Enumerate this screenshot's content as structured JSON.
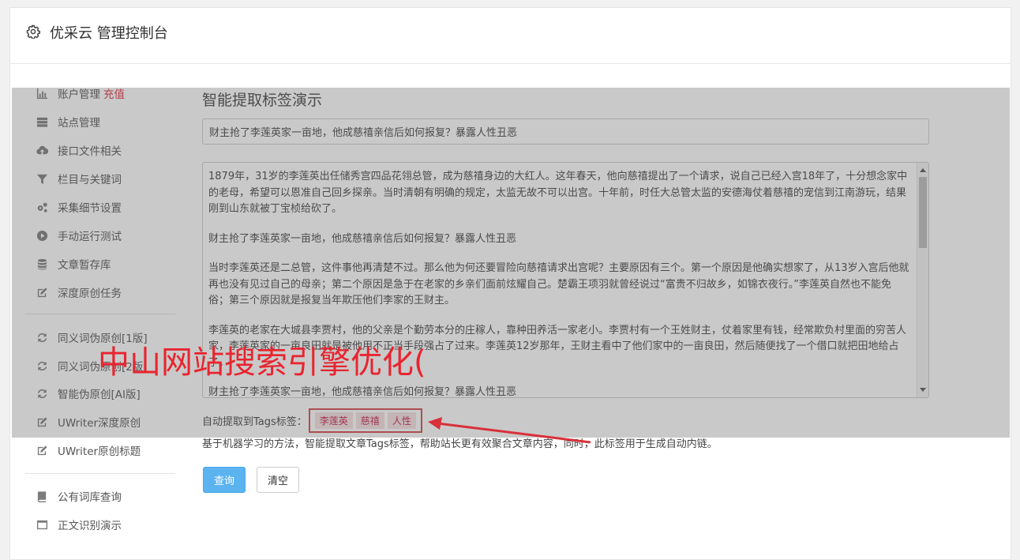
{
  "header": {
    "title": "优采云 管理控制台"
  },
  "sidebar": {
    "items": [
      {
        "label": "账户管理",
        "extra": "充值",
        "icon": "bar-chart-icon"
      },
      {
        "label": "站点管理",
        "icon": "server-icon"
      },
      {
        "label": "接口文件相关",
        "icon": "cloud-upload-icon"
      },
      {
        "label": "栏目与关键词",
        "icon": "filter-icon"
      },
      {
        "label": "采集细节设置",
        "icon": "gears-icon"
      },
      {
        "label": "手动运行测试",
        "icon": "play-circle-icon"
      },
      {
        "label": "文章暂存库",
        "icon": "database-icon"
      },
      {
        "label": "深度原创任务",
        "icon": "edit-icon"
      },
      {
        "label": "同义词伪原创[1版]",
        "icon": "refresh-icon"
      },
      {
        "label": "同义词伪原创[2版]",
        "icon": "refresh-icon"
      },
      {
        "label": "智能伪原创[AI版]",
        "icon": "refresh-icon"
      },
      {
        "label": "UWriter深度原创",
        "icon": "edit-icon"
      },
      {
        "label": "UWriter原创标题",
        "icon": "edit-icon"
      },
      {
        "label": "公有词库查询",
        "icon": "book-icon"
      },
      {
        "label": "正文识别演示",
        "icon": "window-icon"
      }
    ]
  },
  "main": {
    "title": "智能提取标签演示",
    "title_input_value": "财主抢了李莲英家一亩地，他成慈禧亲信后如何报复？暴露人性丑恶",
    "content_paragraphs": [
      "1879年，31岁的李莲英出任储秀宫四品花翎总管，成为慈禧身边的大红人。这年春天，他向慈禧提出了一个请求，说自己已经入宫18年了，十分想念家中的老母，希望可以恩准自己回乡探亲。当时清朝有明确的规定，太监无故不可以出宫。十年前，时任大总管太监的安德海仗着慈禧的宠信到江南游玩，结果刚到山东就被丁宝桢给砍了。",
      "财主抢了李莲英家一亩地，他成慈禧亲信后如何报复？暴露人性丑恶",
      "当时李莲英还是二总管，这件事他再清楚不过。那么他为何还要冒险向慈禧请求出宫呢？主要原因有三个。第一个原因是他确实想家了，从13岁入宫后他就再也没有见过自己的母亲；第二个原因是急于在老家的乡亲们面前炫耀自己。楚霸王项羽就曾经说过“富贵不归故乡，如锦衣夜行。”李莲英自然也不能免俗；第三个原因就是报复当年欺压他们李家的王财主。",
      "李莲英的老家在大城县李贾村，他的父亲是个勤劳本分的庄稼人，靠种田养活一家老小。李贾村有一个王姓财主，仗着家里有钱，经常欺负村里面的穷苦人家，李莲英家的一亩良田就是被他用不正当手段强占了过来。李莲英12岁那年，王财主看中了他们家中的一亩良田，然后随便找了一个借口就把田地给占了。",
      "财主抢了李莲英家一亩地，他成慈禧亲信后如何报复？暴露人性丑恶"
    ],
    "tags_label": "自动提取到Tags标签：",
    "tags": [
      "李莲英",
      "慈禧",
      "人性"
    ],
    "help_text": "基于机器学习的方法，智能提取文章Tags标签，帮助站长更有效聚合文章内容，同时，此标签用于生成自动内链。",
    "query_button": "查询",
    "clear_button": "清空"
  },
  "watermark": "中山网站搜索引擎优化("
}
